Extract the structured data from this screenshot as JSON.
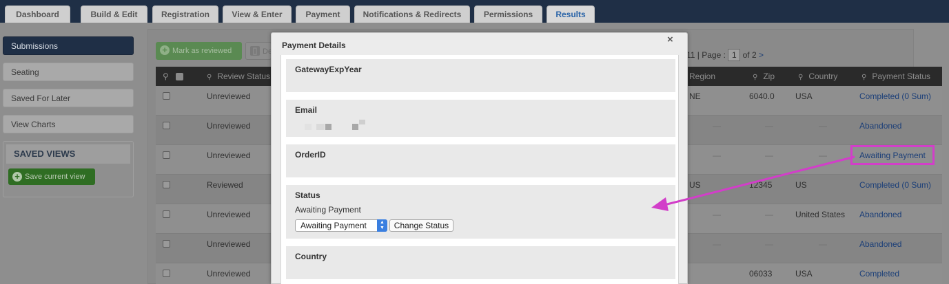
{
  "nav": {
    "tabs": [
      {
        "label": "Dashboard"
      },
      {
        "label": "Build & Edit"
      },
      {
        "label": "Registration"
      },
      {
        "label": "View & Enter"
      },
      {
        "label": "Payment"
      },
      {
        "label": "Notifications & Redirects"
      },
      {
        "label": "Permissions"
      },
      {
        "label": "Results",
        "active": true
      }
    ]
  },
  "sidebar": {
    "items": [
      {
        "label": "Submissions",
        "active": true
      },
      {
        "label": "Seating"
      },
      {
        "label": "Saved For Later"
      },
      {
        "label": "View Charts"
      }
    ],
    "saved_views_title": "SAVED VIEWS",
    "save_current_view_label": "Save current view"
  },
  "toolbar": {
    "mark_reviewed_label": "Mark as reviewed",
    "delete_label": "De"
  },
  "pager": {
    "prefix": "11 | Page :",
    "current": "1",
    "of": "of 2",
    "next": ">"
  },
  "table": {
    "headers": {
      "review_status": "Review Status",
      "region": "Region",
      "zip": "Zip",
      "country": "Country",
      "payment_status": "Payment Status"
    },
    "rows": [
      {
        "review": "Unreviewed",
        "region": "NE",
        "zip": "6040.0",
        "country": "USA",
        "payment": "Completed (0 Sum)"
      },
      {
        "review": "Unreviewed",
        "region": "—",
        "zip": "—",
        "country": "—",
        "payment": "Abandoned"
      },
      {
        "review": "Unreviewed",
        "region": "—",
        "zip": "—",
        "country": "—",
        "payment": "Awaiting Payment"
      },
      {
        "review": "Reviewed",
        "region": "US",
        "zip": "12345",
        "country": "US",
        "payment": "Completed (0 Sum)"
      },
      {
        "review": "Unreviewed",
        "region": "—",
        "zip": "—",
        "country": "United States",
        "payment": "Abandoned"
      },
      {
        "review": "Unreviewed",
        "region": "—",
        "zip": "—",
        "country": "—",
        "payment": "Abandoned"
      },
      {
        "review": "Unreviewed",
        "region": "",
        "zip": "06033",
        "country": "USA",
        "payment": "Completed"
      }
    ]
  },
  "modal": {
    "title": "Payment Details",
    "close_glyph": "×",
    "fields": {
      "gateway_label": "GatewayExpYear",
      "email_label": "Email",
      "order_label": "OrderID",
      "status_label": "Status",
      "status_value": "Awaiting Payment",
      "status_select_value": "Awaiting Payment",
      "change_status_label": "Change Status",
      "country_label": "Country"
    }
  },
  "annotation": {
    "color": "#d23ec9"
  }
}
